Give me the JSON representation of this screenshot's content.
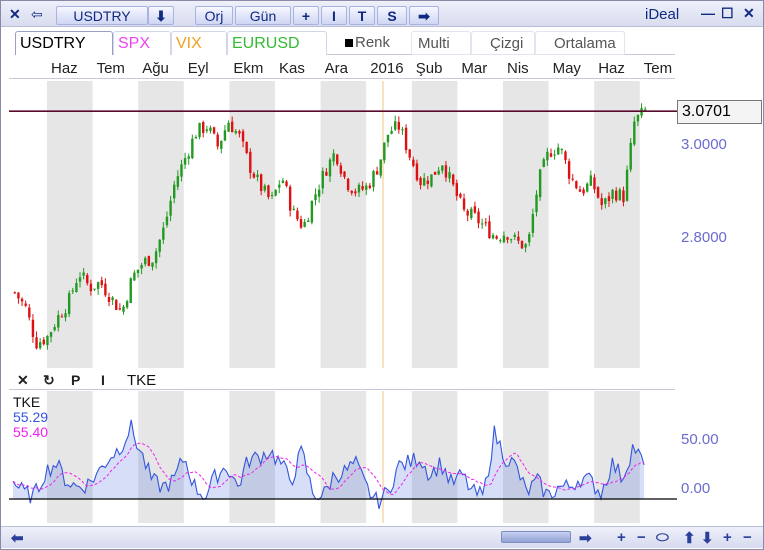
{
  "titlebar": {
    "close_label": "✕",
    "back_label": "⇦",
    "symbol_label": "USDTRY",
    "dropdown_label": "⬇",
    "orj_label": "Orj",
    "period_label": "Gün",
    "plus_label": "+",
    "i_label": "I",
    "t_label": "T",
    "s_label": "S",
    "arrow_label": "➡",
    "brand": "iDeal",
    "minimize_label": "—",
    "maximize_label": "☐",
    "close_win_label": "✕"
  },
  "tabs": [
    {
      "label": "USDTRY",
      "color": "#000000"
    },
    {
      "label": "SPX",
      "color": "#ee44ee"
    },
    {
      "label": "VIX",
      "color": "#f0a020"
    },
    {
      "label": "EURUSD",
      "color": "#33bb33"
    }
  ],
  "options": {
    "renk_label": "Renk",
    "multi_label": "Multi",
    "cizgi_label": "Çizgi",
    "ortalama_label": "Ortalama"
  },
  "months": [
    "Haz",
    "Tem",
    "Ağu",
    "Eyl",
    "Ekm",
    "Kas",
    "Ara",
    "2016",
    "Şub",
    "Mar",
    "Nis",
    "May",
    "Haz",
    "Tem"
  ],
  "price_axis": {
    "last_value": "3.0701",
    "ticks": [
      "3.0000",
      "2.8000"
    ]
  },
  "indicator_toolbar": {
    "close_label": "✕",
    "refresh_label": "↻",
    "p_label": "P",
    "i_label": "I",
    "title": "TKE"
  },
  "indicator_legend": {
    "name": "TKE",
    "value1": "55.29",
    "value2": "55.40",
    "color1": "#3355dd",
    "color2": "#ee22ee"
  },
  "indicator_axis": {
    "ticks": [
      "50.00",
      "0.00"
    ]
  },
  "bottombar": {
    "left_label": "⬅",
    "right_label": "➡",
    "plus_label": "+",
    "minus_label": "−",
    "oval_label": "⬭",
    "up_label": "⬆",
    "down_label": "⬇",
    "plus2_label": "+",
    "minus2_label": "−"
  },
  "chart_data": [
    {
      "type": "candlestick",
      "title": "USDTRY",
      "x_labels": [
        "Haz",
        "Tem",
        "Ağu",
        "Eyl",
        "Ekm",
        "Kas",
        "Ara",
        "2016",
        "Şub",
        "Mar",
        "Nis",
        "May",
        "Haz",
        "Tem"
      ],
      "ylim": [
        2.56,
        3.13
      ],
      "y_ticks": [
        3.0,
        2.8
      ],
      "last_value": 3.0701,
      "up_color": "#229922",
      "down_color": "#dd1111",
      "close_path": [
        2.71,
        2.68,
        2.61,
        2.62,
        2.66,
        2.69,
        2.75,
        2.72,
        2.73,
        2.7,
        2.67,
        2.74,
        2.77,
        2.78,
        2.84,
        2.93,
        2.98,
        3.03,
        3.04,
        3.0,
        3.05,
        3.02,
        2.96,
        2.92,
        2.89,
        2.94,
        2.87,
        2.84,
        2.9,
        2.95,
        2.99,
        2.93,
        2.91,
        2.92,
        2.96,
        3.03,
        3.04,
        2.98,
        2.93,
        2.94,
        2.97,
        2.92,
        2.87,
        2.86,
        2.84,
        2.82,
        2.83,
        2.81,
        2.8,
        2.93,
        2.99,
        3.0,
        2.94,
        2.91,
        2.93,
        2.88,
        2.91,
        2.9,
        3.05,
        3.07
      ],
      "indicator": {
        "type": "line",
        "name": "TKE",
        "ylim": [
          -40,
          180
        ],
        "y_ticks": [
          50,
          0
        ],
        "series": [
          {
            "name": "TKE",
            "value": 55.29,
            "color": "#3355dd"
          },
          {
            "name": "TKE avg",
            "value": 55.4,
            "color": "#ee22ee"
          }
        ],
        "tke_path": [
          30,
          10,
          5,
          45,
          60,
          30,
          20,
          25,
          45,
          70,
          85,
          120,
          75,
          30,
          20,
          30,
          70,
          20,
          5,
          40,
          55,
          20,
          65,
          70,
          80,
          60,
          30,
          80,
          10,
          5,
          40,
          45,
          60,
          20,
          -5,
          10,
          55,
          60,
          70,
          40,
          60,
          25,
          40,
          10,
          5,
          110,
          70,
          55,
          10,
          30,
          5,
          20,
          20,
          35,
          30,
          10,
          60,
          35,
          90,
          55
        ]
      }
    }
  ]
}
